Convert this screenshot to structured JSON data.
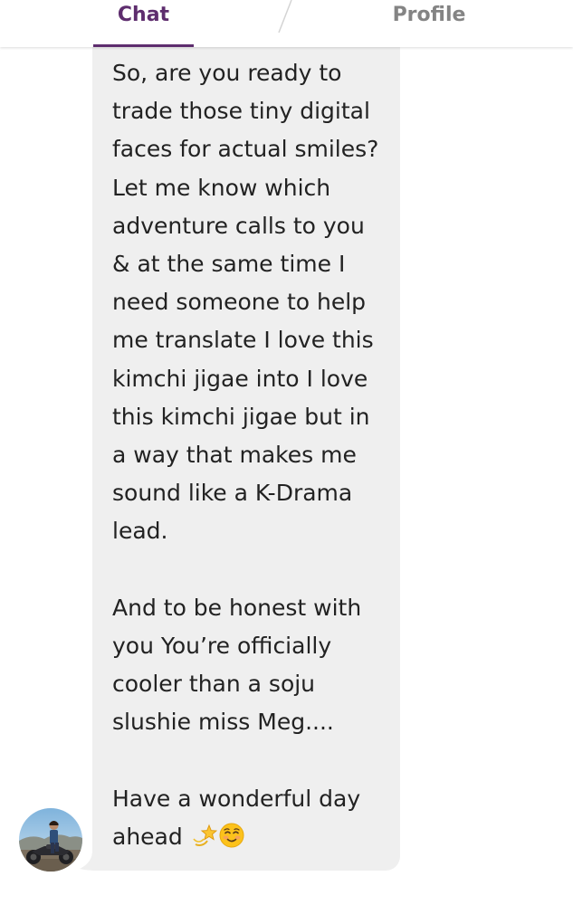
{
  "tabs": {
    "chat_label": "Chat",
    "profile_label": "Profile",
    "active": "Chat"
  },
  "message": {
    "paragraph1": "So, are you ready to trade those tiny digital faces for actual smiles? Let me know which adventure calls to you & at the same time I need someone to help me translate I love this kimchi jigae into I love this kimchi jigae but in a way that makes me sound like a K-Drama lead.",
    "paragraph2": "And to be honest with you You’re officially cooler than a soju slushie miss Meg....",
    "paragraph3": "Have a wonderful day ahead",
    "emojis": [
      "dizzy-star-emoji",
      "smiling-face-emoji"
    ]
  },
  "colors": {
    "accent": "#5e2d6e",
    "inactive_tab": "#848484",
    "bubble": "#efefef",
    "text": "#222222"
  }
}
